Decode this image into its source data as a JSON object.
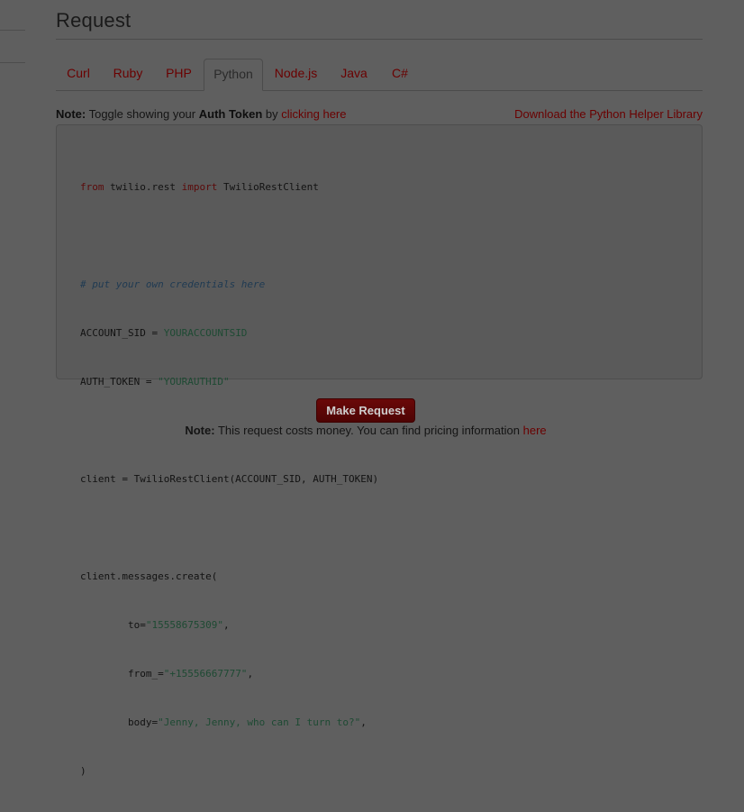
{
  "section": {
    "title": "Request"
  },
  "tabs": [
    {
      "label": "Curl"
    },
    {
      "label": "Ruby"
    },
    {
      "label": "PHP"
    },
    {
      "label": "Python",
      "active": true
    },
    {
      "label": "Node.js"
    },
    {
      "label": "Java"
    },
    {
      "label": "C#"
    }
  ],
  "note": {
    "prefix": "Note:",
    "text_before": " Toggle showing your ",
    "auth_token": "Auth Token",
    "text_by": " by ",
    "link": "clicking here",
    "download_link": "Download the Python Helper Library"
  },
  "code": {
    "line1": {
      "kw1": "from",
      "mod": " twilio.rest ",
      "kw2": "import",
      "rest": " TwilioRestClient"
    },
    "comment": "# put your own credentials here",
    "sid_label": "ACCOUNT_SID = ",
    "sid_value": "YOURACCOUNTSID",
    "token_label": "AUTH_TOKEN = ",
    "token_value": "\"YOURAUTHID\"",
    "client_line": "client = TwilioRestClient(ACCOUNT_SID, AUTH_TOKEN)",
    "create_line": "client.messages.create(",
    "to_label": "        to=",
    "to_value": "\"15558675309\"",
    "to_comma": ",",
    "from_label": "        from_=",
    "from_value": "\"+15556667777\"",
    "from_comma": ",",
    "body_label": "        body=",
    "body_value": "\"Jenny, Jenny, who can I turn to?\"",
    "body_comma": ",",
    "close": ")"
  },
  "request_button": {
    "label": "Make Request"
  },
  "cost_note": {
    "prefix": "Note:",
    "text": " This request costs money. You can find pricing information ",
    "link": "here"
  }
}
